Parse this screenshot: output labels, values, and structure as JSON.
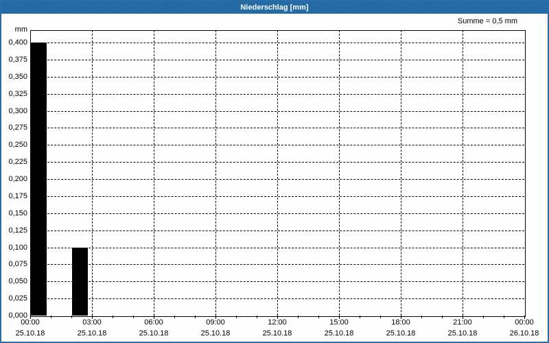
{
  "window": {
    "title": "Niederschlag [mm]"
  },
  "summary_label": "Summe = 0,5 mm",
  "chart_data": {
    "type": "bar",
    "title": "Niederschlag [mm]",
    "xlabel": "",
    "ylabel": "mm",
    "ylim": [
      0,
      0.4
    ],
    "y_tick_step": 0.025,
    "y_ticks": {
      "values": [
        0.4,
        0.375,
        0.35,
        0.325,
        0.3,
        0.275,
        0.25,
        0.225,
        0.2,
        0.175,
        0.15,
        0.125,
        0.1,
        0.075,
        0.05,
        0.025,
        0
      ],
      "labels": [
        "0,400",
        "0,375",
        "0,350",
        "0,325",
        "0,300",
        "0,275",
        "0,250",
        "0,225",
        "0,200",
        "0,175",
        "0,150",
        "0,125",
        "0,100",
        "0,075",
        "0,050",
        "0,025",
        "0,000"
      ]
    },
    "x_axis_hours": 24,
    "x_minor_tick_hours": 1,
    "x_major_tick_hours": 3,
    "x_ticks": [
      {
        "hour": 0,
        "time": "00:00",
        "date": "25.10.18"
      },
      {
        "hour": 3,
        "time": "03:00",
        "date": "25.10.18"
      },
      {
        "hour": 6,
        "time": "06:00",
        "date": "25.10.18"
      },
      {
        "hour": 9,
        "time": "09:00",
        "date": "25.10.18"
      },
      {
        "hour": 12,
        "time": "12:00",
        "date": "25.10.18"
      },
      {
        "hour": 15,
        "time": "15:00",
        "date": "25.10.18"
      },
      {
        "hour": 18,
        "time": "18:00",
        "date": "25.10.18"
      },
      {
        "hour": 21,
        "time": "21:00",
        "date": "25.10.18"
      },
      {
        "hour": 24,
        "time": "00:00",
        "date": "26.10.18"
      }
    ],
    "bars": [
      {
        "start_hour": 0,
        "width_hours": 0.75,
        "value": 0.4
      },
      {
        "start_hour": 2,
        "width_hours": 0.75,
        "value": 0.1
      }
    ],
    "sum_mm": "0,5",
    "grid": "dashed",
    "legend": "none"
  },
  "colors": {
    "titlebar": "#2268a2",
    "frame_border": "#2a6da8",
    "bar": "#000000",
    "grid": "#000000",
    "plot_background": "#fefefe",
    "title_text": "#ffffff",
    "label_text": "#000000"
  }
}
